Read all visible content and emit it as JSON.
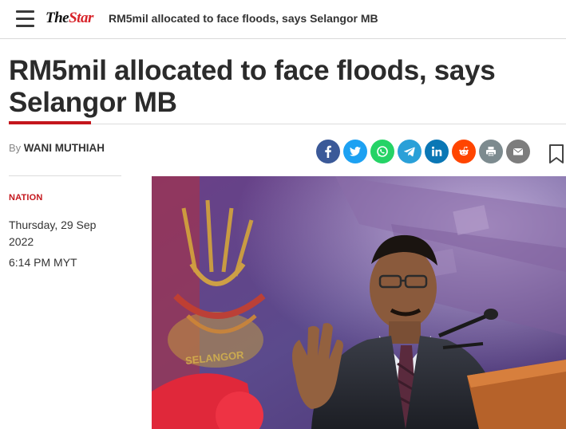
{
  "header": {
    "logo_the": "The",
    "logo_star": "Star",
    "nav_title": "RM5mil allocated to face floods, says Selangor MB"
  },
  "article": {
    "headline": "RM5mil allocated to face floods, says Selangor MB",
    "byline_prefix": "By",
    "author": "WANI MUTHIAH",
    "section": "NATION",
    "date": "Thursday, 29 Sep 2022",
    "time": "6:14 PM MYT"
  },
  "share": [
    {
      "name": "facebook-icon",
      "color": "#3b5998"
    },
    {
      "name": "twitter-icon",
      "color": "#1da1f2"
    },
    {
      "name": "whatsapp-icon",
      "color": "#25d366"
    },
    {
      "name": "telegram-icon",
      "color": "#2aa0d8"
    },
    {
      "name": "linkedin-icon",
      "color": "#0a77b5"
    },
    {
      "name": "reddit-icon",
      "color": "#ff4500"
    },
    {
      "name": "print-icon",
      "color": "#7d8b8f"
    },
    {
      "name": "email-icon",
      "color": "#7d7d7d"
    }
  ],
  "photo": {
    "crest_text": "SELANGOR"
  }
}
